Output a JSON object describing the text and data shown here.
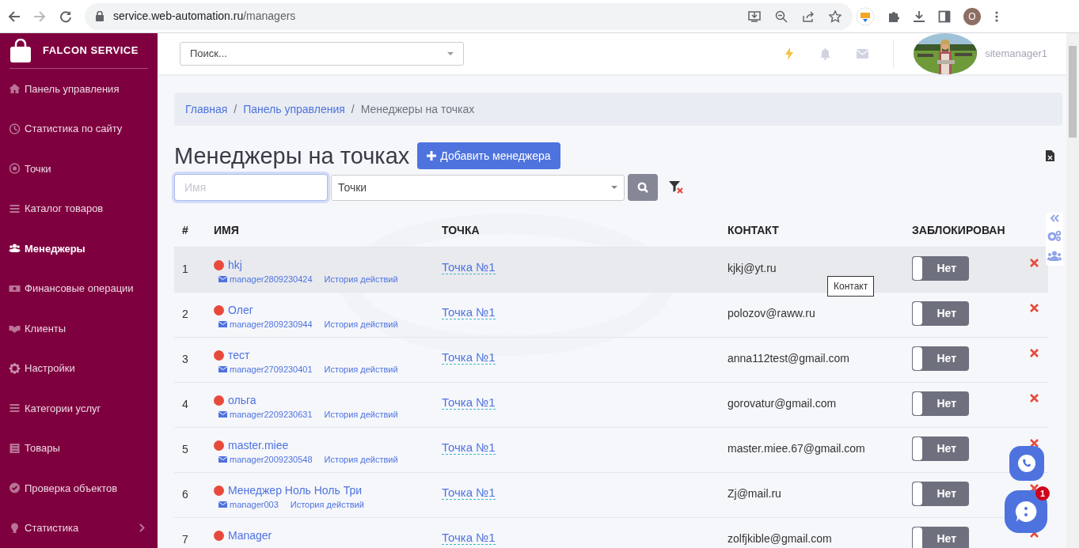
{
  "browser": {
    "url_host": "service.web-automation.ru",
    "url_path": "/managers",
    "profile_initial": "O"
  },
  "sidebar": {
    "brand": "FALCON SERVICE",
    "items": [
      {
        "label": "Панель управления",
        "selected": false
      },
      {
        "label": "Статистика по сайту",
        "selected": false
      },
      {
        "label": "Точки",
        "selected": false
      },
      {
        "label": "Каталог товаров",
        "selected": false
      },
      {
        "label": "Менеджеры",
        "selected": true
      },
      {
        "label": "Финансовые операции",
        "selected": false
      },
      {
        "label": "Клиенты",
        "selected": false
      },
      {
        "label": "Настройки",
        "selected": false
      },
      {
        "label": "Категории услуг",
        "selected": false
      },
      {
        "label": "Товары",
        "selected": false
      },
      {
        "label": "Проверка объектов",
        "selected": false
      },
      {
        "label": "Статистика",
        "selected": false,
        "expandable": true
      }
    ]
  },
  "header": {
    "search_placeholder": "Поиск...",
    "username": "sitemanager1"
  },
  "breadcrumbs": [
    {
      "label": "Главная",
      "link": true,
      "separator": "/"
    },
    {
      "label": "Панель управления",
      "link": true,
      "separator": "/"
    },
    {
      "label": "Менеджеры на точках",
      "link": false
    }
  ],
  "title": "Менеджеры на точках",
  "add_button": "Добавить менеджера",
  "filters": {
    "name_placeholder": "Имя",
    "points_select": "Точки"
  },
  "table": {
    "columns": [
      "#",
      "ИМЯ",
      "ТОЧКА",
      "КОНТАКТ",
      "ЗАБЛОКИРОВАН"
    ],
    "rows": [
      {
        "number": "1",
        "name": "hkj",
        "login": "manager2809230424",
        "history": "История действий",
        "point": "Точка №1",
        "contact": "kjkj@yt.ru",
        "blocked": false,
        "blocked_label": "Нет",
        "hovered": true
      },
      {
        "number": "2",
        "name": "Олег",
        "login": "manager2809230944",
        "history": "История действий",
        "point": "Точка №1",
        "contact": "polozov@raww.ru",
        "blocked": false,
        "blocked_label": "Нет",
        "hovered": false
      },
      {
        "number": "3",
        "name": "тест",
        "login": "manager2709230401",
        "history": "История действий",
        "point": "Точка №1",
        "contact": "anna112test@gmail.com",
        "blocked": false,
        "blocked_label": "Нет",
        "hovered": false
      },
      {
        "number": "4",
        "name": "ольга",
        "login": "manager2209230631",
        "history": "История действий",
        "point": "Точка №1",
        "contact": "gorovatur@gmail.com",
        "blocked": false,
        "blocked_label": "Нет",
        "hovered": false
      },
      {
        "number": "5",
        "name": "master.miee",
        "login": "manager2009230548",
        "history": "История действий",
        "point": "Точка №1",
        "contact": "master.miee.67@gmail.com",
        "blocked": false,
        "blocked_label": "Нет",
        "hovered": false
      },
      {
        "number": "6",
        "name": "Менеджер Ноль Ноль Три",
        "login": "manager003",
        "history": "История действий",
        "point": "Точка №1",
        "contact": "Zj@mail.ru",
        "blocked": false,
        "blocked_label": "Нет",
        "hovered": false
      },
      {
        "number": "7",
        "name": "Manager",
        "point": "Точка №1",
        "contact": "zolfjkible@gmail.com",
        "blocked": false,
        "blocked_label": "Нет",
        "hovered": false
      }
    ]
  },
  "tooltip": "Контакт",
  "chat_badge": "1"
}
